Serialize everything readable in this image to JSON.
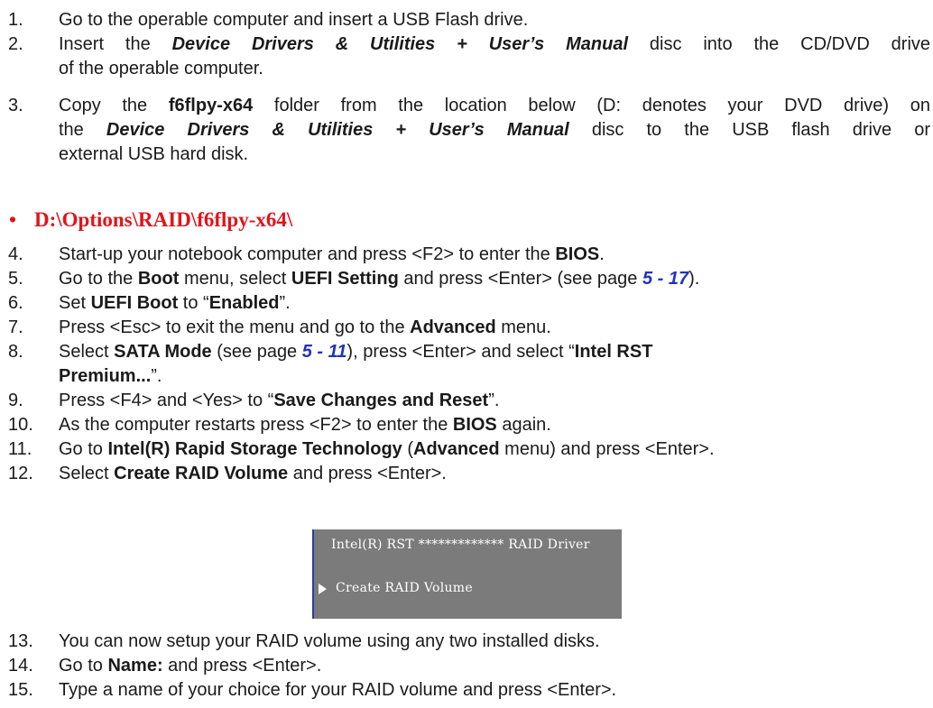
{
  "steps_a": [
    {
      "num": "1.",
      "parts": [
        {
          "t": "Go to the operable computer and insert a USB Flash drive.",
          "s": ""
        }
      ]
    },
    {
      "num": "2.",
      "lines": [
        [
          {
            "t": "Insert the ",
            "s": ""
          },
          {
            "t": "Device Drivers & Utilities + User’s Manual",
            "s": "bi"
          },
          {
            "t": " disc into the CD/DVD drive",
            "s": ""
          }
        ],
        [
          {
            "t": "of the operable computer.",
            "s": ""
          }
        ]
      ]
    },
    {
      "num": "3.",
      "lines": [
        [
          {
            "t": "Copy the ",
            "s": ""
          },
          {
            "t": "f6flpy-x64",
            "s": "b"
          },
          {
            "t": " folder from the location below (D: denotes your DVD drive) on",
            "s": ""
          }
        ],
        [
          {
            "t": "the ",
            "s": ""
          },
          {
            "t": "Device Drivers & Utilities + User’s Manual",
            "s": "bi"
          },
          {
            "t": " disc to the USB flash drive or",
            "s": ""
          }
        ],
        [
          {
            "t": "external USB hard disk.",
            "s": ""
          }
        ]
      ]
    }
  ],
  "path_bullet": "•",
  "path": "D:\\Options\\RAID\\f6flpy-x64\\",
  "steps_b": [
    {
      "num": "4.",
      "parts": [
        {
          "t": "Start-up your notebook computer and press <F2> to enter the ",
          "s": ""
        },
        {
          "t": "BIOS",
          "s": "b"
        },
        {
          "t": ".",
          "s": ""
        }
      ]
    },
    {
      "num": "5.",
      "parts": [
        {
          "t": "Go to the ",
          "s": ""
        },
        {
          "t": "Boot",
          "s": "b"
        },
        {
          "t": " menu, select ",
          "s": ""
        },
        {
          "t": "UEFI Setting",
          "s": "b"
        },
        {
          "t": " and press <Enter> (see page ",
          "s": ""
        },
        {
          "t": "5 - 17",
          "s": "ref"
        },
        {
          "t": ").",
          "s": ""
        }
      ]
    },
    {
      "num": "6.",
      "parts": [
        {
          "t": "Set ",
          "s": ""
        },
        {
          "t": "UEFI Boot",
          "s": "b"
        },
        {
          "t": " to “",
          "s": ""
        },
        {
          "t": "Enabled",
          "s": "b"
        },
        {
          "t": "”.",
          "s": ""
        }
      ]
    },
    {
      "num": "7.",
      "parts": [
        {
          "t": "Press <Esc> to exit the menu and go to the ",
          "s": ""
        },
        {
          "t": "Advanced",
          "s": "b"
        },
        {
          "t": " menu.",
          "s": ""
        }
      ]
    },
    {
      "num": "8.",
      "lines": [
        [
          {
            "t": "Select ",
            "s": ""
          },
          {
            "t": "SATA Mode",
            "s": "b"
          },
          {
            "t": " (see page ",
            "s": ""
          },
          {
            "t": "5 - 11",
            "s": "ref"
          },
          {
            "t": "), press <Enter> and select “",
            "s": ""
          },
          {
            "t": "Intel RST",
            "s": "b"
          }
        ],
        [
          {
            "t": "Premium...",
            "s": "b"
          },
          {
            "t": "”.",
            "s": ""
          }
        ]
      ]
    },
    {
      "num": "9.",
      "parts": [
        {
          "t": "Press <F4> and <Yes> to “",
          "s": ""
        },
        {
          "t": "Save Changes and Reset",
          "s": "b"
        },
        {
          "t": "”.",
          "s": ""
        }
      ]
    },
    {
      "num": "10.",
      "parts": [
        {
          "t": "As the computer restarts press <F2> to enter the ",
          "s": ""
        },
        {
          "t": "BIOS",
          "s": "b"
        },
        {
          "t": " again.",
          "s": ""
        }
      ]
    },
    {
      "num": "11.",
      "parts": [
        {
          "t": "Go to ",
          "s": ""
        },
        {
          "t": "Intel(R) Rapid Storage Technology",
          "s": "b"
        },
        {
          "t": " (",
          "s": ""
        },
        {
          "t": "Advanced",
          "s": "b"
        },
        {
          "t": " menu) and press <Enter>.",
          "s": ""
        }
      ]
    },
    {
      "num": "12.",
      "parts": [
        {
          "t": "Select ",
          "s": ""
        },
        {
          "t": "Create RAID Volume",
          "s": "b"
        },
        {
          "t": " and press <Enter>.",
          "s": ""
        }
      ]
    }
  ],
  "bios": {
    "header": "Intel(R) RST ************* RAID Driver",
    "item": "Create RAID Volume"
  },
  "steps_c": [
    {
      "num": "13.",
      "parts": [
        {
          "t": "You can now setup your RAID volume using any two installed disks.",
          "s": ""
        }
      ]
    },
    {
      "num": "14.",
      "parts": [
        {
          "t": "Go to ",
          "s": ""
        },
        {
          "t": "Name:",
          "s": "b"
        },
        {
          "t": " and press <Enter>.",
          "s": ""
        }
      ]
    },
    {
      "num": "15.",
      "parts": [
        {
          "t": "Type a name of your choice for your RAID volume and press <Enter>.",
          "s": ""
        }
      ]
    }
  ]
}
